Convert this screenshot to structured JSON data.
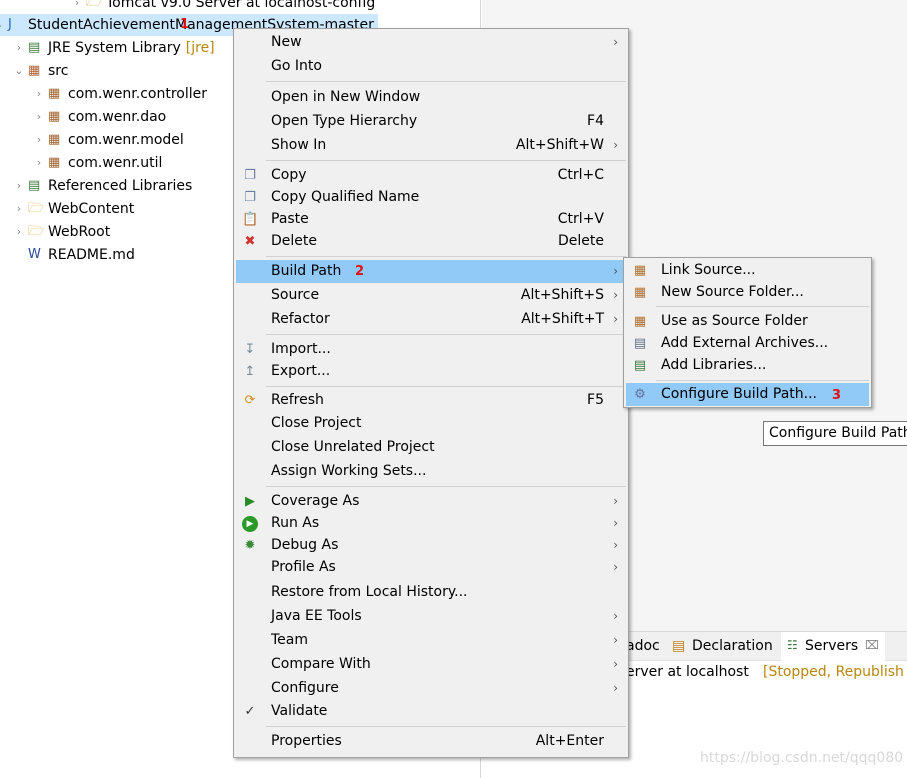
{
  "tree": [
    {
      "label": "Tomcat v9.0 Server at localhost-config",
      "icon": "folder-icon"
    },
    {
      "label": "StudentAchievementManagementSystem-master",
      "icon": "java-project-icon"
    },
    {
      "label": "JRE System Library",
      "suffix": "[jre]",
      "icon": "library-icon"
    },
    {
      "label": "src",
      "icon": "source-folder-icon"
    },
    {
      "label": "com.wenr.controller",
      "icon": "package-icon"
    },
    {
      "label": "com.wenr.dao",
      "icon": "package-icon"
    },
    {
      "label": "com.wenr.model",
      "icon": "package-icon"
    },
    {
      "label": "com.wenr.util",
      "icon": "package-icon"
    },
    {
      "label": "Referenced Libraries",
      "icon": "library-icon"
    },
    {
      "label": "WebContent",
      "icon": "folder-icon"
    },
    {
      "label": "WebRoot",
      "icon": "folder-icon"
    },
    {
      "label": "README.md",
      "icon": "file-icon"
    }
  ],
  "annotations": [
    "1",
    "2",
    "3"
  ],
  "menu": [
    {
      "label": "New",
      "arrow": true
    },
    {
      "label": "Go Into"
    },
    {
      "label": "Open in New Window"
    },
    {
      "label": "Open Type Hierarchy",
      "accel": "F4"
    },
    {
      "label": "Show In",
      "accel": "Alt+Shift+W",
      "arrow": true
    },
    {
      "label": "Copy",
      "accel": "Ctrl+C",
      "icon": "copy-icon"
    },
    {
      "label": "Copy Qualified Name",
      "icon": "copy-qualified-icon"
    },
    {
      "label": "Paste",
      "accel": "Ctrl+V",
      "icon": "paste-icon"
    },
    {
      "label": "Delete",
      "accel": "Delete",
      "icon": "delete-icon"
    },
    {
      "label": "Build Path",
      "arrow": true,
      "highlighted": true
    },
    {
      "label": "Source",
      "accel": "Alt+Shift+S",
      "arrow": true
    },
    {
      "label": "Refactor",
      "accel": "Alt+Shift+T",
      "arrow": true
    },
    {
      "label": "Import...",
      "icon": "import-icon"
    },
    {
      "label": "Export...",
      "icon": "export-icon"
    },
    {
      "label": "Refresh",
      "accel": "F5",
      "icon": "refresh-icon"
    },
    {
      "label": "Close Project"
    },
    {
      "label": "Close Unrelated Project"
    },
    {
      "label": "Assign Working Sets..."
    },
    {
      "label": "Coverage As",
      "arrow": true,
      "icon": "coverage-icon"
    },
    {
      "label": "Run As",
      "arrow": true,
      "icon": "run-icon"
    },
    {
      "label": "Debug As",
      "arrow": true,
      "icon": "debug-icon"
    },
    {
      "label": "Profile As",
      "arrow": true
    },
    {
      "label": "Restore from Local History..."
    },
    {
      "label": "Java EE Tools",
      "arrow": true
    },
    {
      "label": "Team",
      "arrow": true
    },
    {
      "label": "Compare With",
      "arrow": true
    },
    {
      "label": "Configure",
      "arrow": true
    },
    {
      "label": "Validate",
      "icon": "checkbox-icon"
    },
    {
      "label": "Properties",
      "accel": "Alt+Enter"
    }
  ],
  "submenu": [
    {
      "label": "Link Source...",
      "icon": "link-source-icon"
    },
    {
      "label": "New Source Folder...",
      "icon": "new-source-folder-icon"
    },
    {
      "label": "Use as Source Folder",
      "icon": "use-source-folder-icon"
    },
    {
      "label": "Add External Archives...",
      "icon": "jar-icon"
    },
    {
      "label": "Add Libraries...",
      "icon": "library-icon"
    },
    {
      "label": "Configure Build Path...",
      "icon": "configure-icon",
      "highlighted": true
    }
  ],
  "tooltip": "Configure Build Path",
  "bottom_panel": {
    "tabs": [
      {
        "label": "adoc"
      },
      {
        "label": "Declaration"
      },
      {
        "label": "Servers",
        "active": true
      }
    ],
    "server_name": "erver at localhost",
    "server_status": "[Stopped, Republish"
  },
  "watermark": "https://blog.csdn.net/qqq080",
  "colors": {
    "highlight": "#91c9f7",
    "selection": "#cce8ff",
    "annotation": "#e01010",
    "status": "#b8860b"
  }
}
